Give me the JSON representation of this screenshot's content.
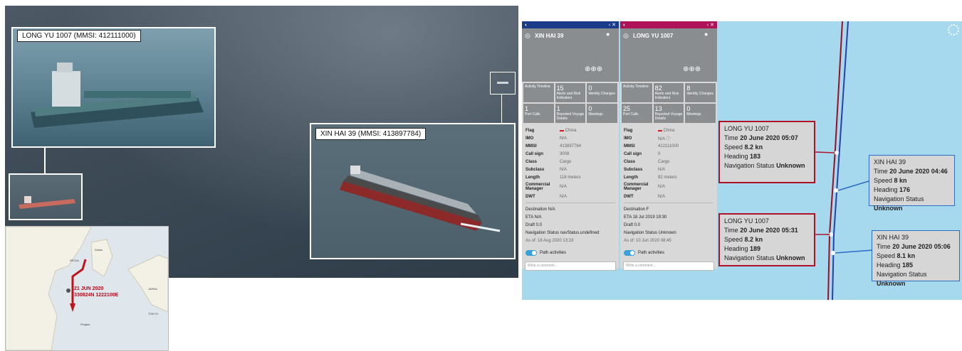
{
  "photo": {
    "inset_top_caption": "LONG YU 1007 (MMSI: 412111000)",
    "inset_right_caption": "XIN HAI 39 (MMSI: 413897784)"
  },
  "map": {
    "date": "21 JUN 2020",
    "coords": "330824N 1222100E",
    "labels": [
      "SEOUL",
      "JAPAN",
      "TOKYO",
      "Dalian",
      "Pingtan"
    ]
  },
  "panels": [
    {
      "title": "XIN HAI 39",
      "accent": "#1a3a8a",
      "tiles": [
        {
          "num": "",
          "label": "Activity Timeline"
        },
        {
          "num": "15",
          "label": "Alerts and Risk Indicators"
        },
        {
          "num": "0",
          "label": "Identity Changes"
        },
        {
          "num": "1",
          "label": "Port Calls"
        },
        {
          "num": "1",
          "label": "Reported Voyage Details"
        },
        {
          "num": "0",
          "label": "Meetings"
        }
      ],
      "rows": [
        {
          "k": "Flag",
          "v": "China"
        },
        {
          "k": "IMO",
          "v": "N/A"
        },
        {
          "k": "MMSI",
          "v": "413897784"
        },
        {
          "k": "Call sign",
          "v": "3008"
        },
        {
          "k": "Class",
          "v": "Cargo"
        },
        {
          "k": "Subclass",
          "v": "N/A"
        },
        {
          "k": "Length",
          "v": "118 meters"
        },
        {
          "k": "Commercial Manager",
          "v": "N/A"
        },
        {
          "k": "DWT",
          "v": "N/A"
        }
      ],
      "destination": "Destination N/A",
      "eta": "ETA N/A",
      "draft": "Draft 0.0",
      "nav": "Navigation Status navStatus.undefined",
      "asof": "As of: 18 Aug 2020 13:23",
      "toggle_label": "Path activities",
      "comment_placeholder": "Write a comment..."
    },
    {
      "title": "LONG YU 1007",
      "accent": "#b0125a",
      "tiles": [
        {
          "num": "",
          "label": "Activity Timeline"
        },
        {
          "num": "82",
          "label": "Alerts and Risk Indicators"
        },
        {
          "num": "8",
          "label": "Identity Changes"
        },
        {
          "num": "25",
          "label": "Port Calls"
        },
        {
          "num": "13",
          "label": "Reported Voyage Details"
        },
        {
          "num": "0",
          "label": "Meetings"
        }
      ],
      "rows": [
        {
          "k": "Flag",
          "v": "China"
        },
        {
          "k": "IMO",
          "v": "N/A"
        },
        {
          "k": "MMSI",
          "v": "412111000"
        },
        {
          "k": "Call sign",
          "v": "0"
        },
        {
          "k": "Class",
          "v": "Cargo"
        },
        {
          "k": "Subclass",
          "v": "N/A"
        },
        {
          "k": "Length",
          "v": "92 meters"
        },
        {
          "k": "Commercial Manager",
          "v": "N/A"
        },
        {
          "k": "DWT",
          "v": "N/A"
        }
      ],
      "destination": "Destination F",
      "eta": "ETA 18 Jul 2019 19:30",
      "draft": "Draft 0.0",
      "nav": "Navigation Status Unknown",
      "asof": "As of: 10 Jun 2020 08:45",
      "toggle_label": "Path activities",
      "comment_placeholder": "Write a comment..."
    }
  ],
  "tooltips": [
    {
      "ship": "LONG YU 1007",
      "time_label": "Time",
      "time": "20 June 2020 05:07",
      "speed_label": "Speed",
      "speed": "8.2 kn",
      "heading_label": "Heading",
      "heading": "183",
      "nav_label": "Navigation Status",
      "nav": "Unknown",
      "color": "#b0122a"
    },
    {
      "ship": "XIN HAI 39",
      "time_label": "Time",
      "time": "20 June 2020 04:46",
      "speed_label": "Speed",
      "speed": "8 kn",
      "heading_label": "Heading",
      "heading": "176",
      "nav_label": "Navigation Status",
      "nav": "Unknown",
      "color": "#2b6cc4"
    },
    {
      "ship": "LONG YU 1007",
      "time_label": "Time",
      "time": "20 June 2020 05:31",
      "speed_label": "Speed",
      "speed": "8.2 kn",
      "heading_label": "Heading",
      "heading": "189",
      "nav_label": "Navigation Status",
      "nav": "Unknown",
      "color": "#b0122a"
    },
    {
      "ship": "XIN HAI 39",
      "time_label": "Time",
      "time": "20 June 2020 05:06",
      "speed_label": "Speed",
      "speed": "8.1 kn",
      "heading_label": "Heading",
      "heading": "185",
      "nav_label": "Navigation Status",
      "nav": "Unknown",
      "color": "#2b6cc4"
    }
  ]
}
